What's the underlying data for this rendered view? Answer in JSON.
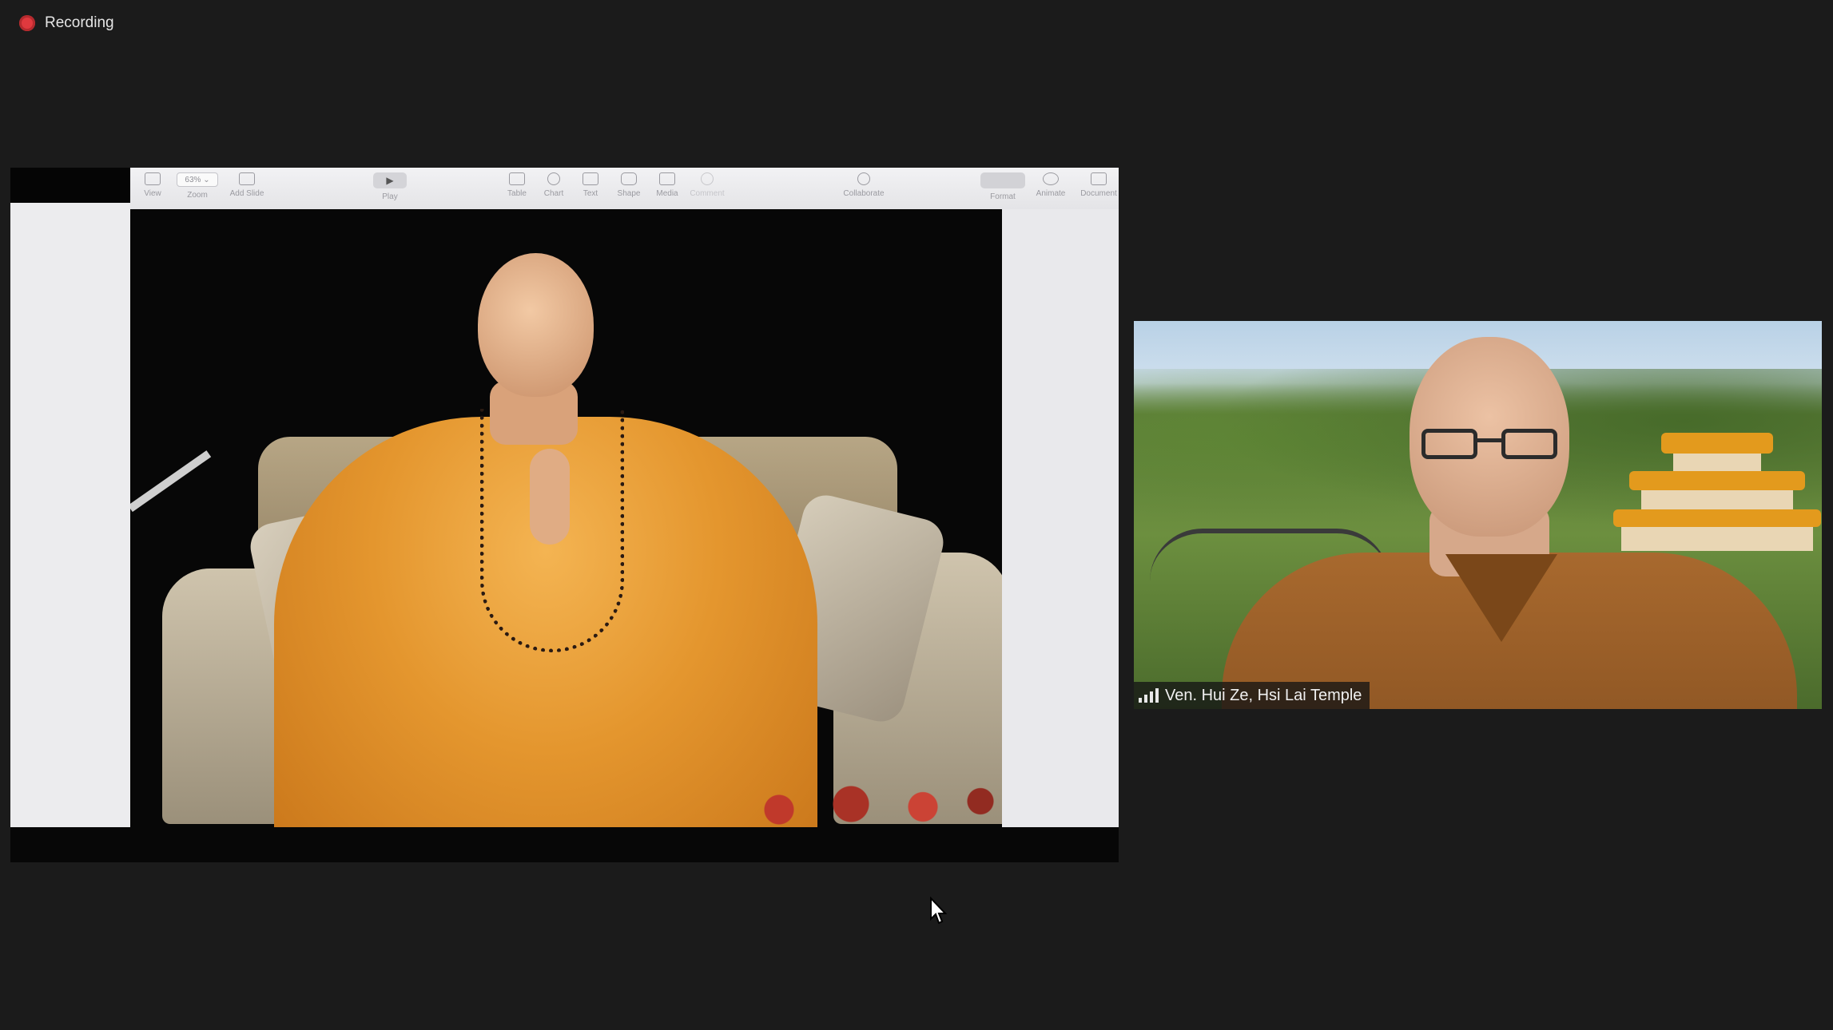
{
  "recording": {
    "label": "Recording"
  },
  "shared_screen": {
    "toolbar": {
      "zoom_value": "63%",
      "items": {
        "view": "View",
        "zoom": "Zoom",
        "add_slide": "Add Slide",
        "play": "Play",
        "table": "Table",
        "chart": "Chart",
        "text": "Text",
        "shape": "Shape",
        "media": "Media",
        "comment": "Comment",
        "collaborate": "Collaborate",
        "format": "Format",
        "animate": "Animate",
        "document": "Document"
      }
    }
  },
  "participant": {
    "name": "Ven. Hui Ze, Hsi Lai Temple"
  },
  "colors": {
    "background": "#1b1b1b",
    "record_red": "#e0393e",
    "robe_orange": "#e4962e"
  }
}
